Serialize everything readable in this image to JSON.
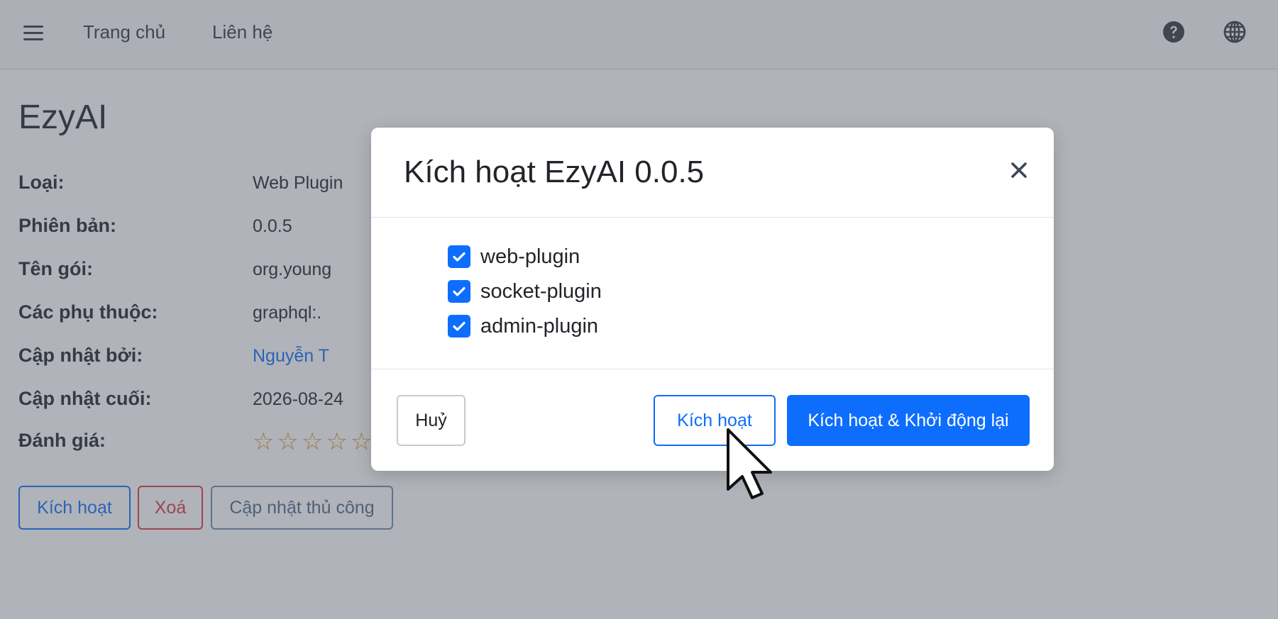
{
  "navbar": {
    "home_label": "Trang chủ",
    "contact_label": "Liên hệ"
  },
  "plugin": {
    "title": "EzyAI",
    "fields": [
      {
        "label": "Loại:",
        "value": "Web Plugin"
      },
      {
        "label": "Phiên bản:",
        "value": "0.0.5"
      },
      {
        "label": "Tên gói:",
        "value": "org.young"
      },
      {
        "label": "Các phụ thuộc:",
        "value": "graphql:."
      },
      {
        "label": "Cập nhật bởi:",
        "value": "Nguyễn T"
      },
      {
        "label": "Cập nhật cuối:",
        "value": "2026-08-24"
      },
      {
        "label": "Đánh giá:",
        "value": ""
      }
    ],
    "rating": 0,
    "rating_max": 5,
    "actions": {
      "activate_label": "Kích hoạt",
      "delete_label": "Xoá",
      "manual_update_label": "Cập nhật thủ công"
    }
  },
  "modal": {
    "title": "Kích hoạt EzyAI 0.0.5",
    "options": [
      {
        "label": "web-plugin",
        "checked": true
      },
      {
        "label": "socket-plugin",
        "checked": true
      },
      {
        "label": "admin-plugin",
        "checked": true
      }
    ],
    "cancel_label": "Huỷ",
    "activate_label": "Kích hoạt",
    "activate_restart_label": "Kích hoạt & Khởi động lại"
  },
  "colors": {
    "primary": "#0d6efd",
    "danger": "#dc3545",
    "star": "#d49a2a"
  }
}
